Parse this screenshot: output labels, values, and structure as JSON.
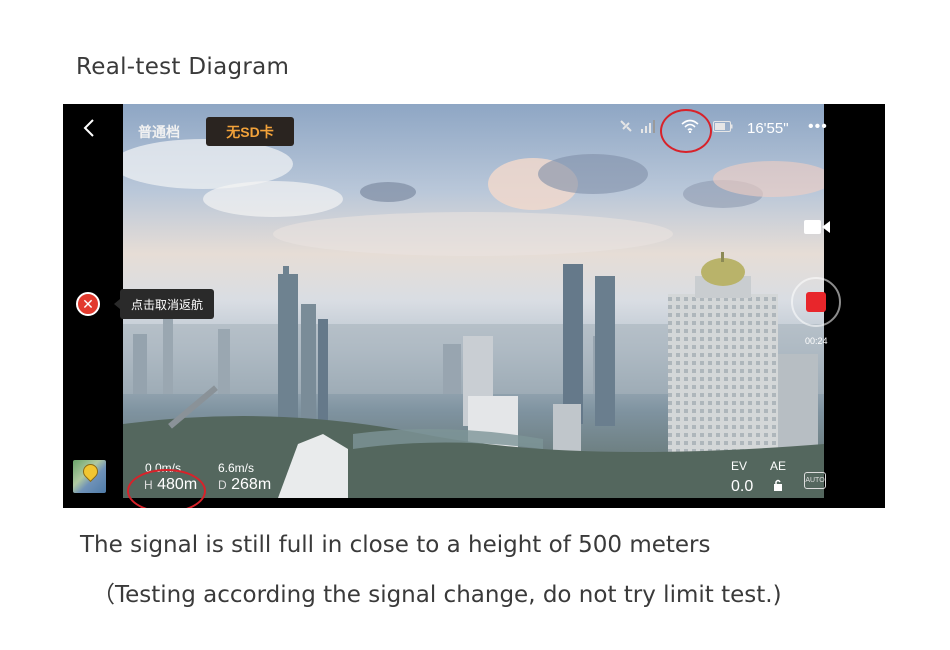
{
  "page": {
    "heading": "Real-test Diagram",
    "caption_line1": "The signal is still full in close to a height of 500 meters",
    "caption_line2": "（Testing according the signal change, do not try limit test.)"
  },
  "top_bar": {
    "back_icon": "chevron-left-icon",
    "mode_label": "普通档",
    "sd_badge": "无SD卡",
    "time_remaining": "16'55\"",
    "more_label": "•••",
    "status_icons": [
      "satellite-icon",
      "signal-bars-icon",
      "wifi-icon",
      "battery-icon"
    ]
  },
  "return_home": {
    "cancel_icon": "✕",
    "tooltip": "点击取消返航"
  },
  "right_controls": {
    "camera_icon": "video-camera-icon",
    "record_time": "00:24"
  },
  "telemetry": {
    "vertical_speed": "0.0m/s",
    "horizontal_speed": "6.6m/s",
    "height": "480m",
    "distance": "268m",
    "height_marker": "H",
    "distance_marker": "D"
  },
  "exposure": {
    "ev_label": "EV",
    "ae_label": "AE",
    "ev_value": "0.0",
    "auto_label": "AUTO"
  },
  "colors": {
    "highlight_circle": "#d8222a",
    "record_red": "#e8262b",
    "sd_badge_text": "#f2a23a"
  }
}
